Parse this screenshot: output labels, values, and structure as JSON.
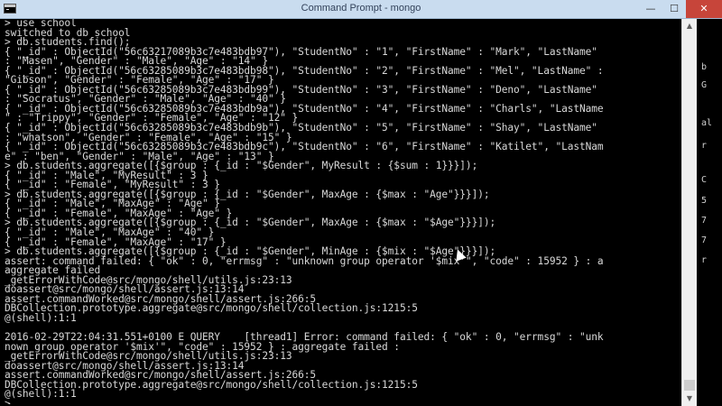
{
  "window": {
    "title": "Command Prompt - mongo",
    "controls": {
      "minimize": "—",
      "maximize": "☐",
      "close": "✕"
    }
  },
  "console": {
    "lines": [
      "> use school",
      "switched to db school",
      "> db.students.find();",
      "{ \"_id\" : ObjectId(\"56c63217089b3c7e483bdb97\"), \"StudentNo\" : \"1\", \"FirstName\" : \"Mark\", \"LastName\"",
      ": \"Masen\", \"Gender\" : \"Male\", \"Age\" : \"14\" }",
      "{ \"_id\" : ObjectId(\"56c63285089b3c7e483bdb98\"), \"StudentNo\" : \"2\", \"FirstName\" : \"Mel\", \"LastName\" :",
      "\"Gibson\", \"Gender\" : \"Female\", \"Age\" : \"17\" }",
      "{ \"_id\" : ObjectId(\"56c63285089b3c7e483bdb99\"), \"StudentNo\" : \"3\", \"FirstName\" : \"Deno\", \"LastName\"",
      ": \"Socratus\", \"Gender\" : \"Male\", \"Age\" : \"40\" }",
      "{ \"_id\" : ObjectId(\"56c63285089b3c7e483bdb9a\"), \"StudentNo\" : \"4\", \"FirstName\" : \"Charls\", \"LastName",
      "\" : \"Trippy\", \"Gender\" : \"Female\", \"Age\" : \"12\" }",
      "{ \"_id\" : ObjectId(\"56c63285089b3c7e483bdb9b\"), \"StudentNo\" : \"5\", \"FirstName\" : \"Shay\", \"LastName\"",
      ": \"whatson\", \"Gender\" : \"Female\", \"Age\" : \"15\" }",
      "{ \"_id\" : ObjectId(\"56c63285089b3c7e483bdb9c\"), \"StudentNo\" : \"6\", \"FirstName\" : \"Katilet\", \"LastNam",
      "e\" : \"ben\", \"Gender\" : \"Male\", \"Age\" : \"13\" }",
      "> db.students.aggregate([{$group : {_id : \"$Gender\", MyResult : {$sum : 1}}}]);",
      "{ \"_id\" : \"Male\", \"MyResult\" : 3 }",
      "{ \"_id\" : \"Female\", \"MyResult\" : 3 }",
      "> db.students.aggregate([{$group : {_id : \"$Gender\", MaxAge : {$max : \"Age\"}}}]);",
      "{ \"_id\" : \"Male\", \"MaxAge\" : \"Age\" }",
      "{ \"_id\" : \"Female\", \"MaxAge\" : \"Age\" }",
      "> db.students.aggregate([{$group : {_id : \"$Gender\", MaxAge : {$max : \"$Age\"}}}]);",
      "{ \"_id\" : \"Male\", \"MaxAge\" : \"40\" }",
      "{ \"_id\" : \"Female\", \"MaxAge\" : \"17\" }",
      "> db.students.aggregate([{$group : {_id : \"$Gender\", MinAge : {$mix : \"$Age\"}}}]);",
      "assert: command failed: { \"ok\" : 0, \"errmsg\" : \"unknown group operator '$mix'\", \"code\" : 15952 } : a",
      "aggregate failed",
      "_getErrorWithCode@src/mongo/shell/utils.js:23:13",
      "doassert@src/mongo/shell/assert.js:13:14",
      "assert.commandWorked@src/mongo/shell/assert.js:266:5",
      "DBCollection.prototype.aggregate@src/mongo/shell/collection.js:1215:5",
      "@(shell):1:1",
      "",
      "2016-02-29T22:04:31.551+0100 E QUERY    [thread1] Error: command failed: { \"ok\" : 0, \"errmsg\" : \"unk",
      "nown group operator '$mix'\", \"code\" : 15952 } : aggregate failed :",
      "_getErrorWithCode@src/mongo/shell/utils.js:23:13",
      "doassert@src/mongo/shell/assert.js:13:14",
      "assert.commandWorked@src/mongo/shell/assert.js:266:5",
      "DBCollection.prototype.aggregate@src/mongo/shell/collection.js:1215:5",
      "@(shell):1:1",
      ">"
    ]
  },
  "background_window": {
    "fragments": [
      "b",
      "G",
      "al",
      "r",
      "C",
      "5",
      "7",
      "7",
      "r"
    ]
  },
  "scrollbar": {
    "up_arrow": "▲",
    "down_arrow": "▼"
  },
  "icons": {
    "app": "console-app-icon",
    "cursor": "mouse-pointer-icon"
  }
}
